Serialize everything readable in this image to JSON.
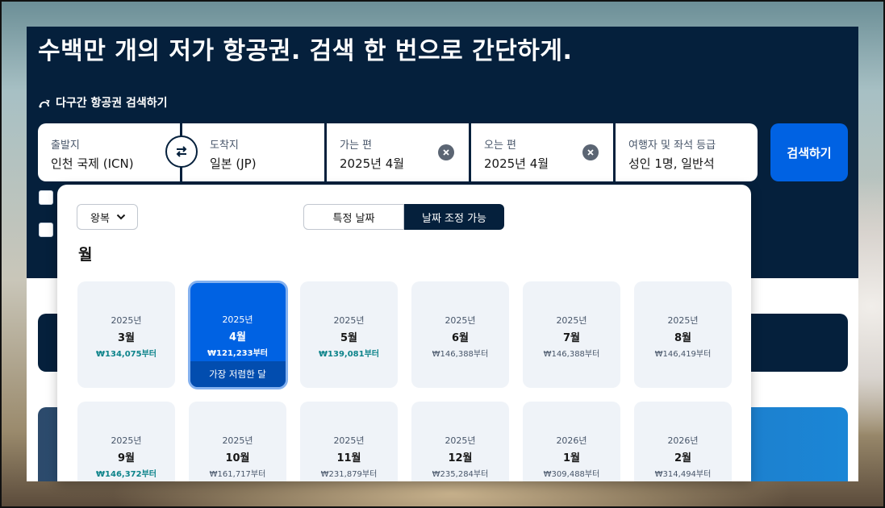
{
  "headline": "수백만 개의 저가 항공권. 검색 한 번으로 간단하게.",
  "multi_city_label": "다구간 항공권 검색하기",
  "search": {
    "origin": {
      "label": "출발지",
      "value": "인천 국제 (ICN)"
    },
    "destination": {
      "label": "도착지",
      "value": "일본 (JP)"
    },
    "depart": {
      "label": "가는 편",
      "value": "2025년 4월"
    },
    "return": {
      "label": "오는 편",
      "value": "2025년 4월"
    },
    "travelers": {
      "label": "여행자 및 좌석 등급",
      "value": "성인 1명, 일반석"
    },
    "button": "검색하기"
  },
  "picker": {
    "trip_type": "왕복",
    "mode_options": [
      "특정 날짜",
      "날짜 조정 가능"
    ],
    "selected_mode": "날짜 조정 가능",
    "section_title": "월",
    "cheapest_tag": "가장 저렴한 달",
    "months": [
      {
        "year": "2025년",
        "month": "3월",
        "price": "₩134,075부터",
        "highlight": true,
        "selected": false
      },
      {
        "year": "2025년",
        "month": "4월",
        "price": "₩121,233부터",
        "highlight": true,
        "selected": true
      },
      {
        "year": "2025년",
        "month": "5월",
        "price": "₩139,081부터",
        "highlight": true,
        "selected": false
      },
      {
        "year": "2025년",
        "month": "6월",
        "price": "₩146,388부터",
        "highlight": false,
        "selected": false
      },
      {
        "year": "2025년",
        "month": "7월",
        "price": "₩146,388부터",
        "highlight": false,
        "selected": false
      },
      {
        "year": "2025년",
        "month": "8월",
        "price": "₩146,419부터",
        "highlight": false,
        "selected": false
      },
      {
        "year": "2025년",
        "month": "9월",
        "price": "₩146,372부터",
        "highlight": true,
        "selected": false
      },
      {
        "year": "2025년",
        "month": "10월",
        "price": "₩161,717부터",
        "highlight": false,
        "selected": false
      },
      {
        "year": "2025년",
        "month": "11월",
        "price": "₩231,879부터",
        "highlight": false,
        "selected": false
      },
      {
        "year": "2025년",
        "month": "12월",
        "price": "₩235,284부터",
        "highlight": false,
        "selected": false
      },
      {
        "year": "2026년",
        "month": "1월",
        "price": "₩309,488부터",
        "highlight": false,
        "selected": false
      },
      {
        "year": "2026년",
        "month": "2월",
        "price": "₩314,494부터",
        "highlight": false,
        "selected": false
      }
    ]
  },
  "colors": {
    "hero": "#05203c",
    "accent": "#0062e3",
    "price_good": "#0c838a"
  },
  "icons": {
    "multi_city": "route-icon",
    "swap": "swap-arrows-icon",
    "clear": "close-circle-icon",
    "dropdown": "chevron-down-icon"
  }
}
